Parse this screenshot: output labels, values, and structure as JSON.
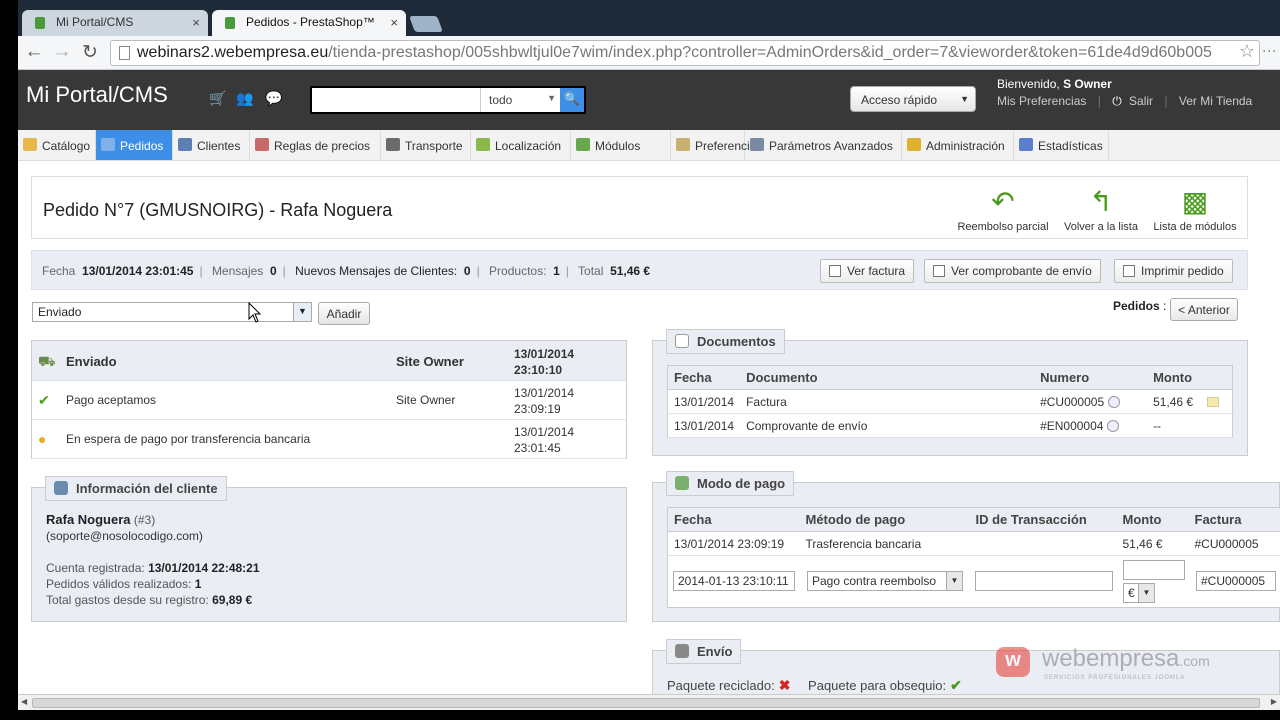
{
  "browser": {
    "tabs": [
      {
        "title": "Mi Portal/CMS"
      },
      {
        "title": "Pedidos - PrestaShop™"
      }
    ],
    "close_glyph": "×",
    "url_host": "webinars2.webempresa.eu",
    "url_path": "/tienda-prestashop/005shbwltjul0e7wim/index.php?controller=AdminOrders&id_order=7&vieworder&token=61de4d9d60b005"
  },
  "header": {
    "logo": "Mi Portal/CMS",
    "search_scope": "todo",
    "quick_access": "Acceso rápido",
    "welcome_prefix": "Bienvenido,",
    "welcome_user": "S Owner",
    "prefs": "Mis Preferencias",
    "logout": "Salir",
    "view_store": "Ver Mi Tienda"
  },
  "menu": [
    {
      "label": "Catálogo",
      "icon": "folder-icon",
      "color": "#e8b84a"
    },
    {
      "label": "Pedidos",
      "icon": "cart-icon",
      "color": "#7fb0e8"
    },
    {
      "label": "Clientes",
      "icon": "user-icon",
      "color": "#5a7fb0"
    },
    {
      "label": "Reglas de precios",
      "icon": "price-rules-icon",
      "color": "#c86a6a"
    },
    {
      "label": "Transporte",
      "icon": "truck-icon",
      "color": "#6b6b6b"
    },
    {
      "label": "Localización",
      "icon": "globe-icon",
      "color": "#8ab84a"
    },
    {
      "label": "Módulos",
      "icon": "puzzle-icon",
      "color": "#6aa84f"
    },
    {
      "label": "Preferencias",
      "icon": "preferences-icon",
      "color": "#c8b070"
    },
    {
      "label": "Parámetros Avanzados",
      "icon": "wrench-icon",
      "color": "#7a8aa0"
    },
    {
      "label": "Administración",
      "icon": "key-icon",
      "color": "#e0b030"
    },
    {
      "label": "Estadísticas",
      "icon": "stats-icon",
      "color": "#5a7fd0"
    }
  ],
  "order": {
    "title": "Pedido N°7 (GMUSNOIRG) - Rafa Noguera",
    "toolbar": {
      "partial_refund": "Reembolso parcial",
      "back_to_list": "Volver a la lista",
      "modules_list": "Lista de módulos"
    },
    "info": {
      "date_label": "Fecha",
      "date_value": "13/01/2014 23:01:45",
      "messages_label": "Mensajes",
      "messages_value": "0",
      "new_messages_label": "Nuevos Mensajes de Clientes:",
      "new_messages_value": "0",
      "products_label": "Productos:",
      "products_value": "1",
      "total_label": "Total",
      "total_value": "51,46 €",
      "sep": "|"
    },
    "buttons": {
      "invoice": "Ver factura",
      "delivery_slip": "Ver comprobante de envío",
      "print": "Imprimir pedido"
    },
    "status_select": "Enviado",
    "add_button": "Añadir",
    "nav_label": "Pedidos",
    "nav_colon": ":",
    "prev_button": "< Anterior",
    "history": [
      {
        "status": "Enviado",
        "who": "Site Owner",
        "date": "13/01/2014",
        "time": "23:10:10",
        "bold": true
      },
      {
        "status": "Pago aceptamos",
        "who": "Site Owner",
        "date": "13/01/2014",
        "time": "23:09:19",
        "bold": false
      },
      {
        "status": "En espera de pago por transferencia bancaria",
        "who": "",
        "date": "13/01/2014",
        "time": "23:01:45",
        "bold": false
      }
    ]
  },
  "client": {
    "legend": "Información del cliente",
    "name": "Rafa Noguera",
    "id": "(#3)",
    "email": "(soporte@nosolocodigo.com)",
    "registered_label": "Cuenta registrada:",
    "registered_value": "13/01/2014 22:48:21",
    "orders_label": "Pedidos válidos realizados:",
    "orders_value": "1",
    "spent_label": "Total gastos desde su registro:",
    "spent_value": "69,89 €"
  },
  "documents": {
    "legend": "Documentos",
    "headers": [
      "Fecha",
      "Documento",
      "Numero",
      "Monto"
    ],
    "rows": [
      {
        "date": "13/01/2014",
        "doc": "Factura",
        "number": "#CU000005",
        "amount": "51,46 €"
      },
      {
        "date": "13/01/2014",
        "doc": "Comprovante de envío",
        "number": "#EN000004",
        "amount": "--"
      }
    ]
  },
  "payment": {
    "legend": "Modo de pago",
    "headers": [
      "Fecha",
      "Método de pago",
      "ID de Transacción",
      "Monto",
      "Factura"
    ],
    "row": {
      "date": "13/01/2014 23:09:19",
      "method": "Trasferencia bancaria",
      "txn": "",
      "amount": "51,46 €",
      "invoice": "#CU000005"
    },
    "form": {
      "date_value": "2014-01-13 23:10:11",
      "method_value": "Pago contra reembolso",
      "currency": "€",
      "invoice_value": "#CU000005"
    }
  },
  "shipping": {
    "legend": "Envío",
    "recycled_label": "Paquete reciclado:",
    "gift_label": "Paquete para obsequio:"
  },
  "watermark": {
    "brand": "webempresa",
    "tld": ".com",
    "tagline": "SERVICIOS PROFESIONALES JOOMLA"
  }
}
